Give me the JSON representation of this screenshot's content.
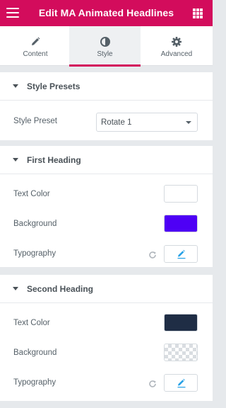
{
  "header": {
    "title": "Edit MA Animated Headlines",
    "menu_icon": "hamburger-menu-icon",
    "apps_icon": "grid-apps-icon"
  },
  "tabs": [
    {
      "label": "Content",
      "icon": "pencil-icon",
      "active": false
    },
    {
      "label": "Style",
      "icon": "half-circle-icon",
      "active": true
    },
    {
      "label": "Advanced",
      "icon": "gear-icon",
      "active": false
    }
  ],
  "sections": {
    "style_presets": {
      "title": "Style Presets",
      "style_preset_label": "Style Preset",
      "style_preset_value": "Rotate 1"
    },
    "first_heading": {
      "title": "First Heading",
      "text_color_label": "Text Color",
      "text_color_value": "#ffffff",
      "background_label": "Background",
      "background_value": "#4e00f5",
      "typography_label": "Typography"
    },
    "second_heading": {
      "title": "Second Heading",
      "text_color_label": "Text Color",
      "text_color_value": "#1f2d45",
      "background_label": "Background",
      "background_value": "transparent",
      "typography_label": "Typography"
    }
  },
  "colors": {
    "accent": "#d30c5c",
    "edit_icon": "#26a1e6",
    "panel_bg": "#e6e9ec"
  }
}
